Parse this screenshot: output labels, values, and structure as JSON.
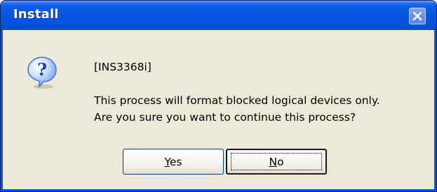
{
  "window": {
    "title": "Install"
  },
  "icons": {
    "close": "close-icon",
    "message": "question-icon"
  },
  "message": {
    "code": "[INS3368i]",
    "line1": "This process will format blocked logical devices only.",
    "line2": "Are you sure you want to continue this process?"
  },
  "buttons": {
    "yes": {
      "mnemonic": "Y",
      "rest": "es"
    },
    "no": {
      "mnemonic": "N",
      "rest": "o"
    }
  },
  "colors": {
    "titlebar": "#0553de",
    "dialog_bg": "#ece9d8",
    "close_button": "#6b93e6",
    "icon_bubble": "#3a6fd8"
  }
}
